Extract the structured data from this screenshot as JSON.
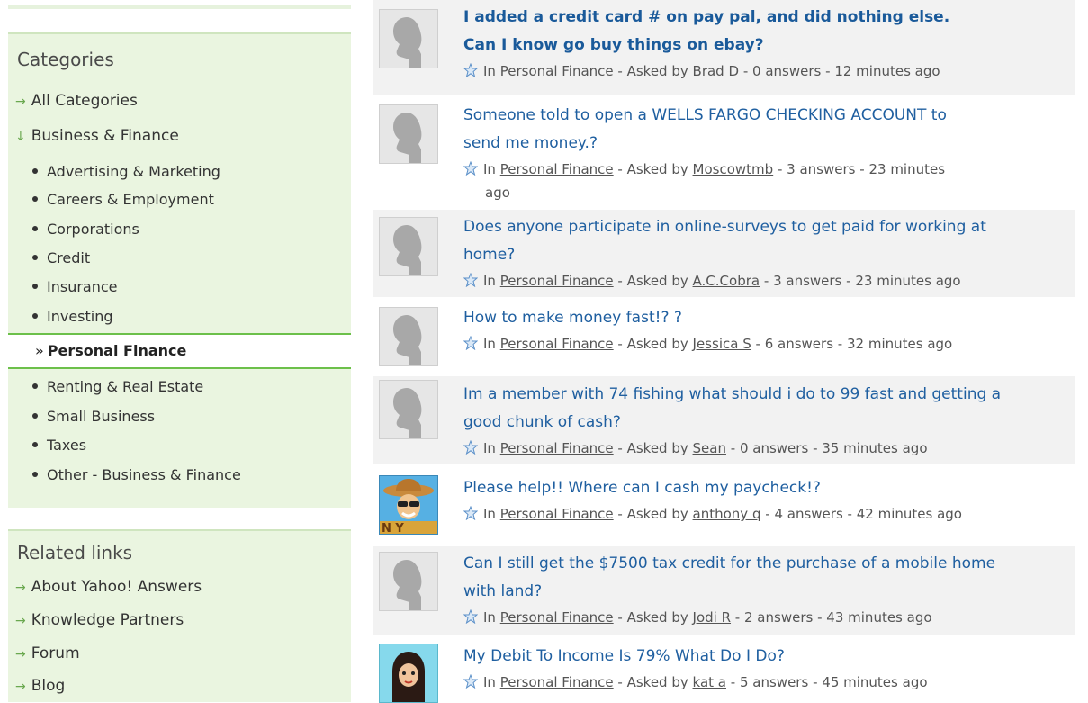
{
  "sidebar": {
    "categories_title": "Categories",
    "all_categories": "All Categories",
    "business_finance": "Business & Finance",
    "subcategories": [
      "Advertising & Marketing",
      "Careers & Employment",
      "Corporations",
      "Credit",
      "Insurance",
      "Investing"
    ],
    "selected": "Personal Finance",
    "subcategories_after": [
      "Renting & Real Estate",
      "Small Business",
      "Taxes",
      "Other - Business & Finance"
    ],
    "related_title": "Related links",
    "related_links": [
      "About Yahoo! Answers",
      "Knowledge Partners",
      "Forum",
      "Blog"
    ]
  },
  "meta_labels": {
    "in": "In",
    "asked_by": "- Asked by",
    "sep": "-"
  },
  "questions": [
    {
      "title_line1": "I added a credit card # on pay pal, and did nothing else.",
      "title_line2": "Can I know go buy things on ebay?",
      "category": "Personal Finance",
      "user": "Brad D",
      "answers": "0 answers",
      "time": "12 minutes ago"
    },
    {
      "title_line1": "Someone told to open a WELLS FARGO CHECKING ACCOUNT to",
      "title_line2": "send me money.?",
      "category": "Personal Finance",
      "user": "Moscowtmb",
      "answers": "3 answers",
      "time": "23 minutes",
      "time_line2": "ago"
    },
    {
      "title_line1": "Does anyone participate in online-surveys to get paid for working at",
      "title_line2": "home?",
      "category": "Personal Finance",
      "user": "A.C.Cobra",
      "answers": "3 answers",
      "time": "23 minutes ago"
    },
    {
      "title_line1": "How to make money fast!? ?",
      "category": "Personal Finance",
      "user": "Jessica S",
      "answers": "6 answers",
      "time": "32 minutes ago"
    },
    {
      "title_line1": "Im a member with 74 fishing what should i do to 99 fast and getting a",
      "title_line2": "good chunk of cash?",
      "category": "Personal Finance",
      "user": "Sean",
      "answers": "0 answers",
      "time": "35 minutes ago"
    },
    {
      "title_line1": "Please help!! Where can I cash my paycheck!?",
      "category": "Personal Finance",
      "user": "anthony q",
      "answers": "4 answers",
      "time": "42 minutes ago"
    },
    {
      "title_line1": "Can I still get the $7500 tax credit for the purchase of a mobile home",
      "title_line2": "with land?",
      "category": "Personal Finance",
      "user": "Jodi R",
      "answers": "2 answers",
      "time": "43 minutes ago"
    },
    {
      "title_line1": "My Debit To Income Is 79% What Do I Do?",
      "category": "Personal Finance",
      "user": "kat a",
      "answers": "5 answers",
      "time": "45 minutes ago"
    }
  ],
  "colors": {
    "link": "#1f5fa0",
    "panel_bg": "#eaf5e0",
    "selected_border": "#6cc04a",
    "arrow": "#6aa84f"
  }
}
